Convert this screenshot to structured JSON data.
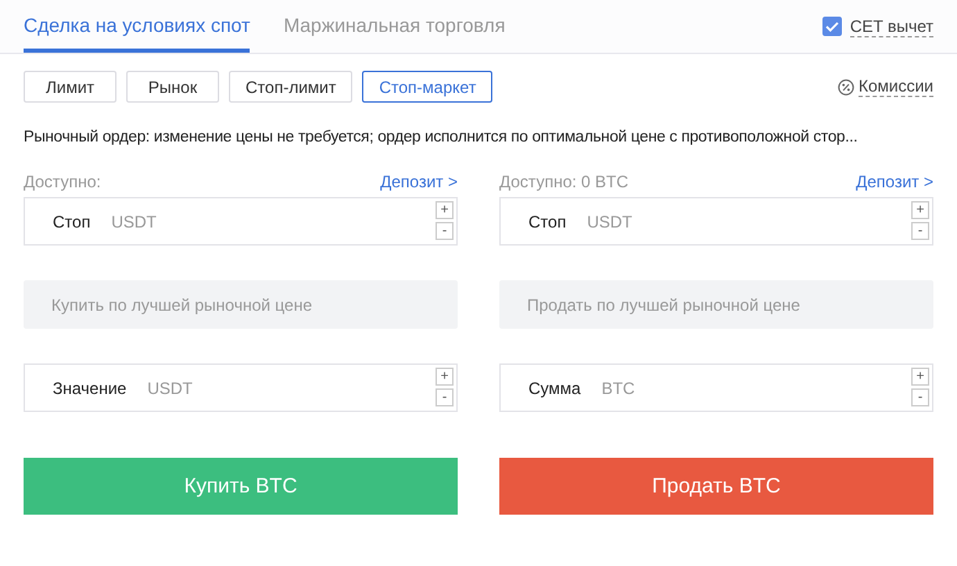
{
  "tabs": [
    {
      "label": "Сделка на условиях спот",
      "selected": true
    },
    {
      "label": "Маржинальная торговля",
      "selected": false
    }
  ],
  "cet_deduction": {
    "label": "CET вычет",
    "checked": true
  },
  "order_types": [
    {
      "label": "Лимит",
      "selected": false
    },
    {
      "label": "Рынок",
      "selected": false
    },
    {
      "label": "Стоп-лимит",
      "selected": false
    },
    {
      "label": "Стоп-маркет",
      "selected": true
    }
  ],
  "fees_link": "Комиссии",
  "description": "Рыночный ордер: изменение цены не требуется; ордер исполнится по оптимальной цене с противоположной стор...",
  "panels": [
    {
      "kind": "buy",
      "available": "Доступно:",
      "deposit": "Депозит >",
      "fields": [
        {
          "kind": "input",
          "label": "Стоп",
          "unit": "USDT",
          "plus": "+",
          "minus": "-"
        },
        {
          "kind": "market",
          "text": "Купить по лучшей рыночной цене"
        },
        {
          "kind": "input",
          "label": "Значение",
          "unit": "USDT",
          "plus": "+",
          "minus": "-"
        }
      ],
      "submit": "Купить BTC"
    },
    {
      "kind": "sell",
      "available": "Доступно: 0 BTC",
      "deposit": "Депозит >",
      "fields": [
        {
          "kind": "input",
          "label": "Стоп",
          "unit": "USDT",
          "plus": "+",
          "minus": "-"
        },
        {
          "kind": "market",
          "text": "Продать по лучшей рыночной цене"
        },
        {
          "kind": "input",
          "label": "Сумма",
          "unit": "BTC",
          "plus": "+",
          "minus": "-"
        }
      ],
      "submit": "Продать BTC"
    }
  ]
}
